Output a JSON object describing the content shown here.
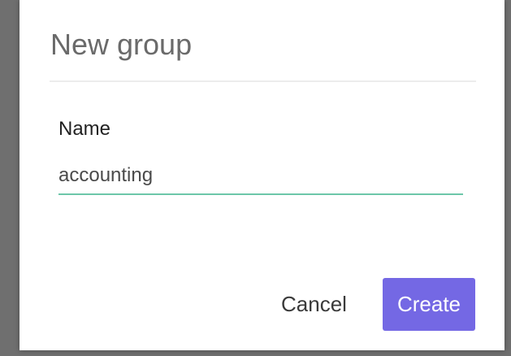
{
  "dialog": {
    "title": "New group",
    "name_label": "Name",
    "name_value": "accounting",
    "cancel_label": "Cancel",
    "create_label": "Create"
  },
  "colors": {
    "accent": "#7468e4",
    "input_underline": "#6dc7a9",
    "backdrop": "#6f6f6f"
  }
}
